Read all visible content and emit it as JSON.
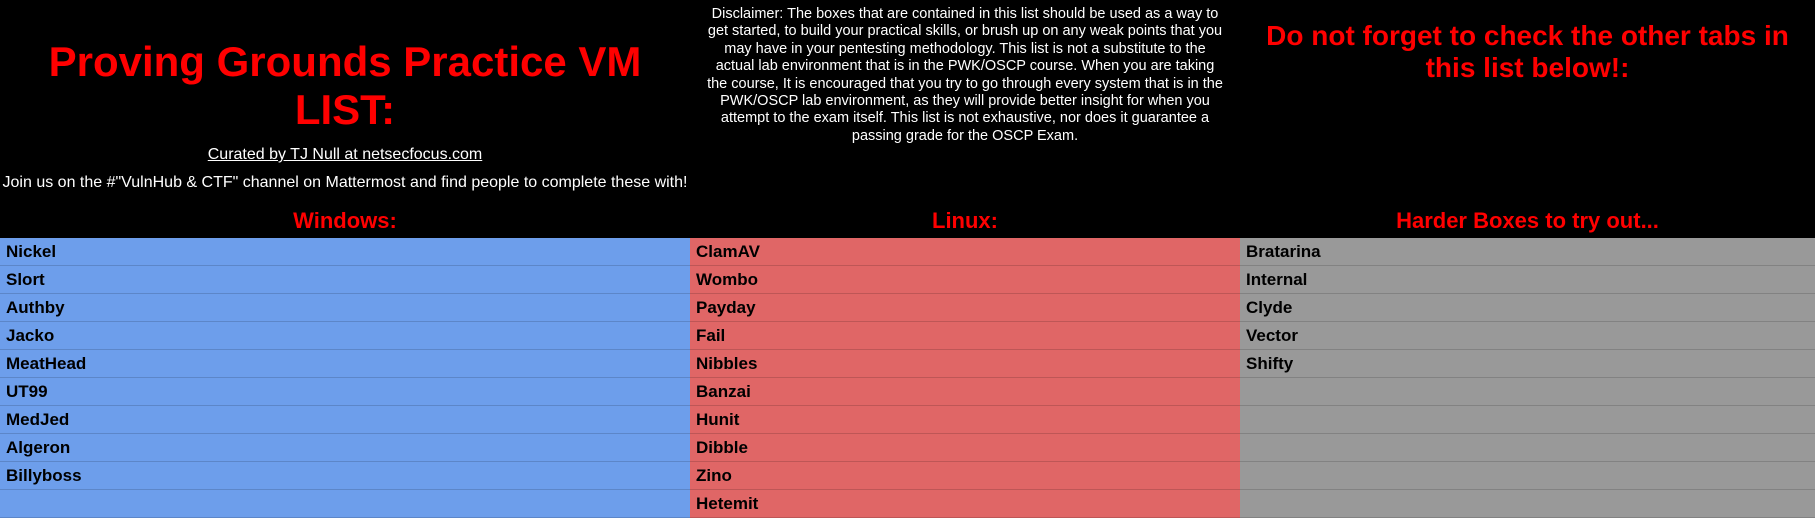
{
  "header": {
    "title": "Proving Grounds Practice VM LIST:",
    "curated": "Curated by TJ Null at netsecfocus.com",
    "join": "Join us on the #\"VulnHub & CTF\" channel on Mattermost and find people to complete these with!",
    "disclaimer": "Disclaimer: The boxes that are contained in this list should be used as a way to get started, to build your practical skills, or brush up on any weak points that you may have in your pentesting methodology. This list is not a substitute to the actual lab environment that is in the PWK/OSCP course. When you are taking the course, It is encouraged that you try to go through every system that is in the PWK/OSCP lab environment, as they will provide better insight for when you attempt to the exam itself. This list is not exhaustive, nor does it guarantee a passing grade for the OSCP Exam.",
    "reminder": "Do not forget to check the other tabs in this list below!:"
  },
  "columns": {
    "windows": {
      "header": "Windows:"
    },
    "linux": {
      "header": "Linux:"
    },
    "harder": {
      "header": "Harder Boxes to try out..."
    }
  },
  "windows": [
    "Nickel",
    "Slort",
    "Authby",
    "Jacko",
    "MeatHead",
    "UT99",
    "MedJed",
    "Algeron",
    "Billyboss",
    ""
  ],
  "linux": [
    "ClamAV",
    "Wombo",
    "Payday",
    "Fail",
    "Nibbles",
    "Banzai",
    "Hunit",
    "Dibble",
    "Zino",
    "Hetemit"
  ],
  "harder": [
    "Bratarina",
    "Internal",
    "Clyde",
    "Vector",
    "Shifty",
    "",
    "",
    "",
    "",
    ""
  ]
}
